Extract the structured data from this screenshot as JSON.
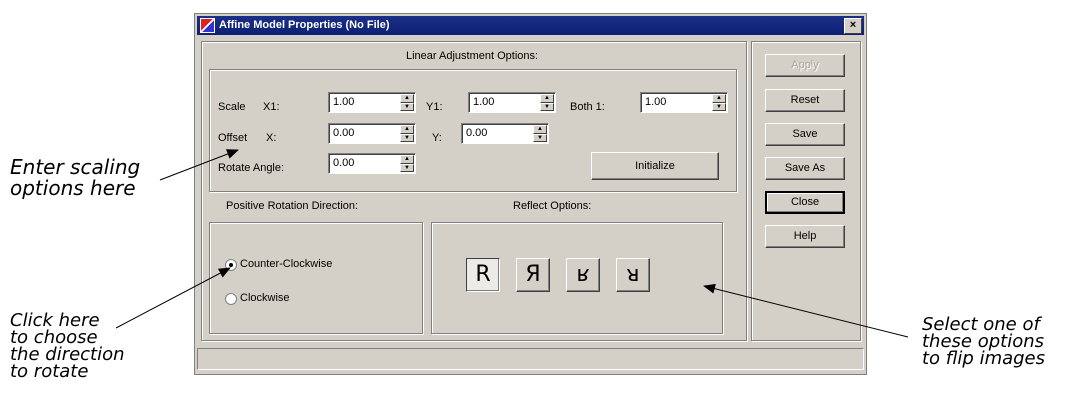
{
  "window": {
    "title": "Affine Model Properties (No File)",
    "close": "×"
  },
  "linear": {
    "title": "Linear Adjustment Options:",
    "scale_label": "Scale",
    "x1_label": "X1:",
    "x1_value": "1.00",
    "y1_label": "Y1:",
    "y1_value": "1.00",
    "both1_label": "Both 1:",
    "both1_value": "1.00",
    "offset_label": "Offset",
    "x_label": "X:",
    "x_value": "0.00",
    "y_label": "Y:",
    "y_value": "0.00",
    "rotate_label": "Rotate Angle:",
    "rotate_value": "0.00",
    "initialize": "Initialize"
  },
  "rotation": {
    "title": "Positive Rotation Direction:",
    "options": [
      "Counter-Clockwise",
      "Clockwise"
    ],
    "selected": "Counter-Clockwise"
  },
  "reflect": {
    "title": "Reflect Options:",
    "buttons": [
      "R",
      "Я",
      "ʁ",
      "ᴚ"
    ]
  },
  "side_buttons": {
    "apply": "Apply",
    "reset": "Reset",
    "save": "Save",
    "save_as": "Save As",
    "close": "Close",
    "help": "Help"
  },
  "spin_up": "▲",
  "spin_down": "▼",
  "annotations": {
    "scaling": [
      "Enter scaling",
      "options here"
    ],
    "direction": [
      "Click here",
      "to choose",
      "the direction",
      "to rotate"
    ],
    "flip": [
      "Select one of",
      "these options",
      "to flip images"
    ]
  }
}
